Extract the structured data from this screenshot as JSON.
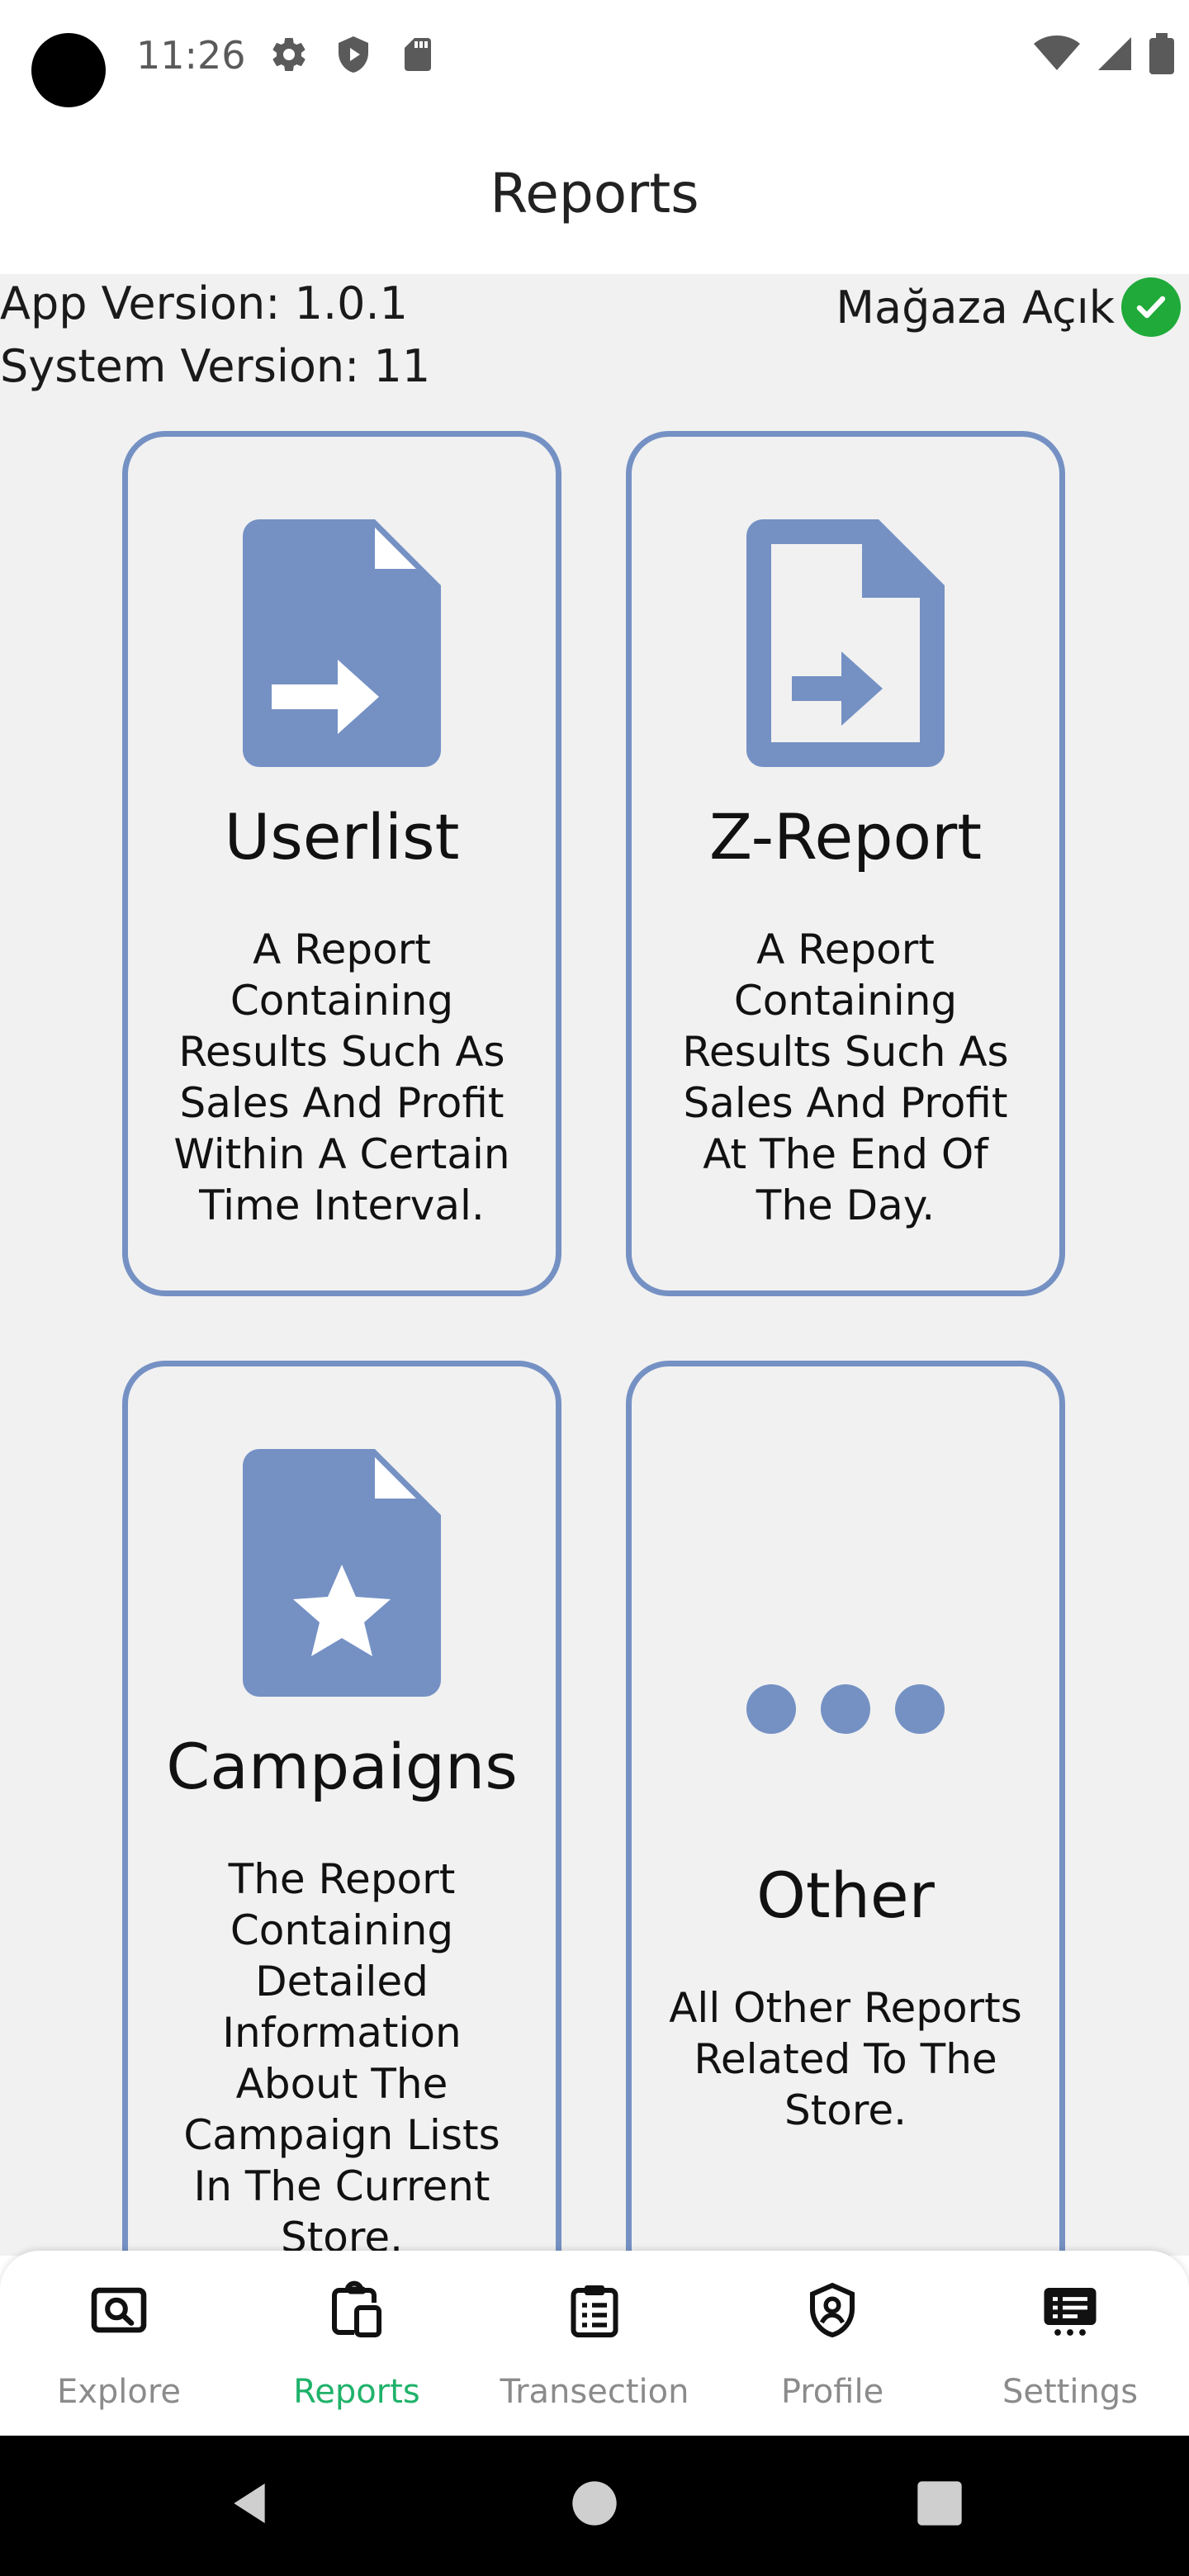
{
  "status_bar": {
    "time": "11:26"
  },
  "header": {
    "title": "Reports"
  },
  "info": {
    "app_version": "App Version: 1.0.1",
    "system_version": "System Version: 11",
    "store_status": "Mağaza Açık"
  },
  "cards": [
    {
      "title": "Userlist",
      "description": "A Report Containing Results Such As Sales And Profit Within A Certain Time Interval.",
      "icon": "file-arrow-icon"
    },
    {
      "title": "Z-Report",
      "description": "A Report Containing Results Such As Sales And Profit At The End Of The Day.",
      "icon": "file-outline-arrow-icon"
    },
    {
      "title": "Campaigns",
      "description": "The Report Containing Detailed Information About The Campaign Lists In The Current Store.",
      "icon": "file-star-icon"
    },
    {
      "title": "Other",
      "description": "All Other Reports Related To The Store.",
      "icon": "more-dots-icon"
    }
  ],
  "bottom_nav": [
    {
      "label": "Explore",
      "icon": "search-box-icon",
      "active": false
    },
    {
      "label": "Reports",
      "icon": "clipboard-copy-icon",
      "active": true
    },
    {
      "label": "Transection",
      "icon": "clipboard-list-icon",
      "active": false
    },
    {
      "label": "Profile",
      "icon": "shield-user-icon",
      "active": false
    },
    {
      "label": "Settings",
      "icon": "settings-list-icon",
      "active": false
    }
  ],
  "colors": {
    "accent": "#7591c4",
    "active_nav": "#1fb26a",
    "status_ok": "#1faa3a"
  }
}
